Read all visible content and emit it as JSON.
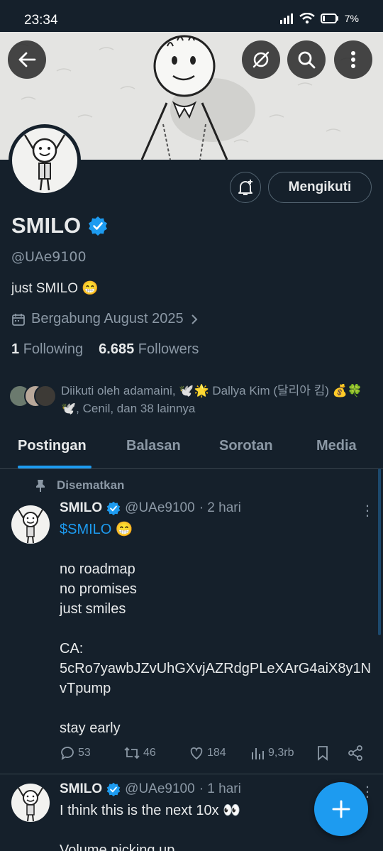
{
  "status": {
    "time": "23:34",
    "battery": "7%"
  },
  "profile": {
    "name": "SMILO",
    "handle": "@UAe9100",
    "bio": "just SMILO 😁",
    "joined": "Bergabung August 2025",
    "following_count": "1",
    "following_label": "Following",
    "followers_count": "6.685",
    "followers_label": "Followers",
    "followed_by": "Diikuti oleh adamaini, 🕊️🌟 Dallya Kim (달리아 킴) 💰🍀🕊️, Cenil, dan 38 lainnya",
    "follow_button": "Mengikuti"
  },
  "tabs": [
    {
      "label": "Postingan",
      "active": true
    },
    {
      "label": "Balasan"
    },
    {
      "label": "Sorotan"
    },
    {
      "label": "Media"
    }
  ],
  "pinned_label": "Disematkan",
  "tweets": [
    {
      "name": "SMILO",
      "handle": "@UAe9100",
      "time": "· 2 hari",
      "cashtag": "$SMILO",
      "cashtag_suffix": " 😁",
      "body": "no roadmap\nno promises\njust smiles\n\nCA:\n5cRo7yawbJZvUhGXvjAZRdgPLeXArG4aiX8y1NvTpump\n\nstay early",
      "replies": "53",
      "retweets": "46",
      "likes": "184",
      "views": "9,3rb"
    },
    {
      "name": "SMILO",
      "handle": "@UAe9100",
      "time": "· 1 hari",
      "body": "I think this is the next 10x 👀\n\nVolume picking up"
    }
  ],
  "colors": {
    "accent": "#1d9bf0",
    "background": "#15202b",
    "muted": "#8b98a5"
  }
}
